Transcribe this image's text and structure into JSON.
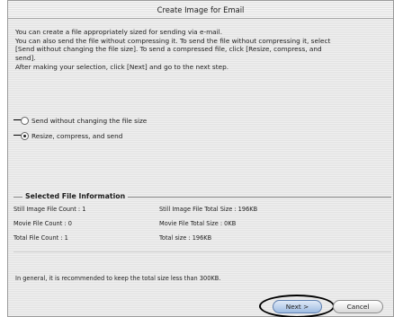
{
  "window": {
    "title": "Create Image for Email"
  },
  "intro": {
    "lines": [
      "You can create a file appropriately sized for sending via e-mail.",
      "You can also send the file without compressing it. To send the file without compressing it, select",
      "[Send without changing the file size]. To send a compressed file, click [Resize, compress, and",
      "send].",
      "After making your selection, click [Next] and go to the next step."
    ]
  },
  "options": {
    "send_without_changing": {
      "label": "Send without changing the file size",
      "checked": false
    },
    "resize_compress_send": {
      "label": "Resize, compress, and send",
      "checked": true
    }
  },
  "selected_file_information": {
    "title": "Selected File Information",
    "still_image_file_count": "Still Image File Count : 1",
    "still_image_file_total_size": "Still Image File Total Size : 196KB",
    "movie_file_count": "Movie File Count : 0",
    "movie_file_total_size": "Movie File Total Size : 0KB",
    "total_file_count": "Total File Count : 1",
    "total_size": "Total size : 196KB"
  },
  "note": "In general, it is recommended to  keep the total size less than 300KB.",
  "buttons": {
    "next": "Next >",
    "cancel": "Cancel"
  }
}
